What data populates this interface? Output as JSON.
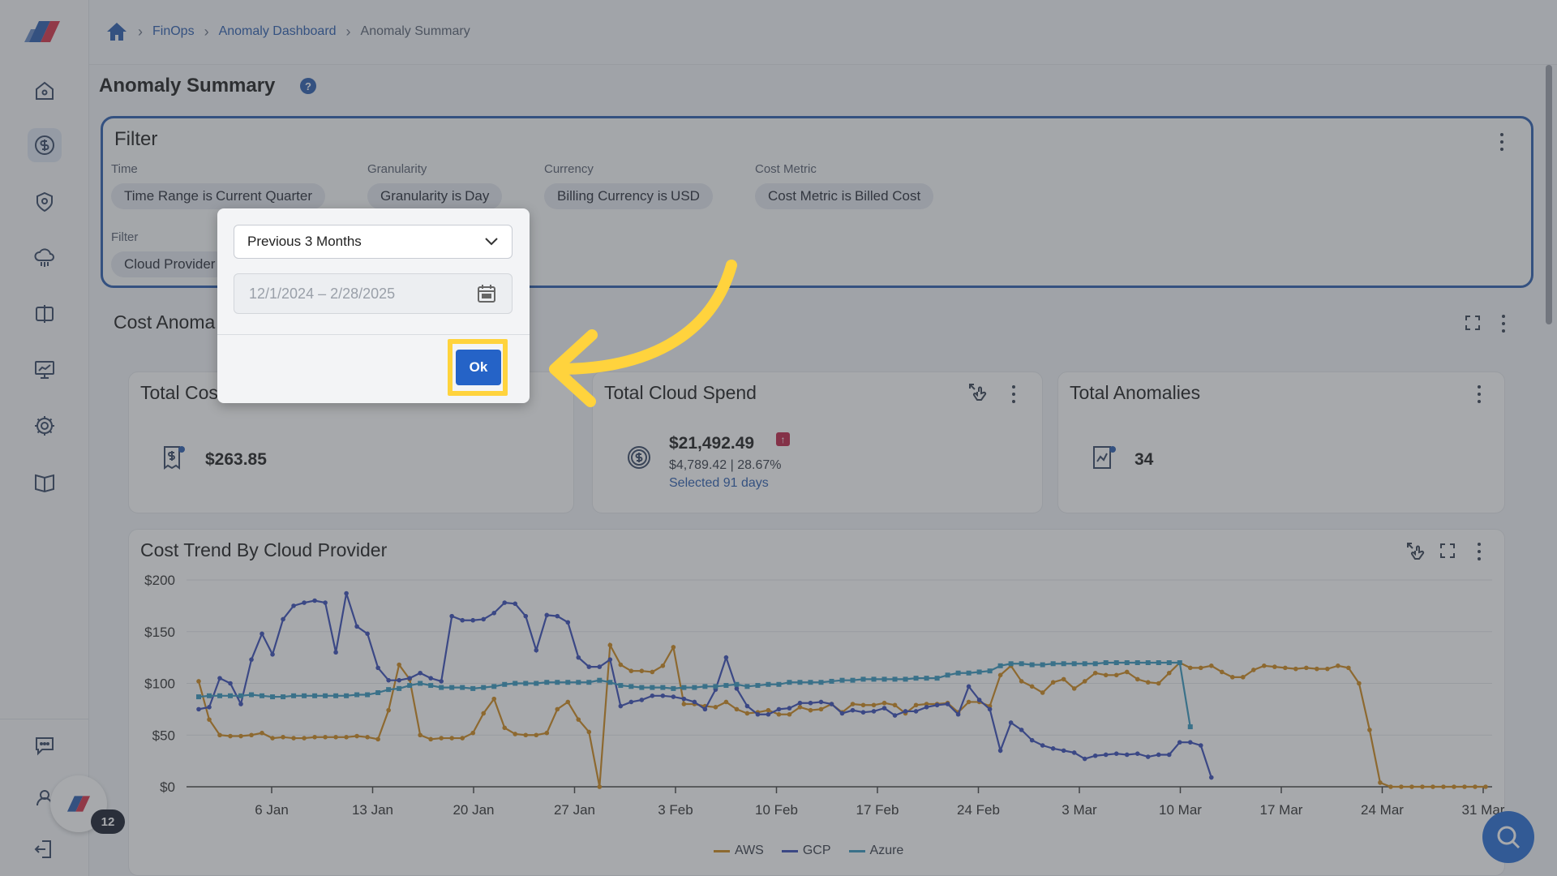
{
  "breadcrumb": {
    "items": [
      "FinOps",
      "Anomaly Dashboard"
    ],
    "current": "Anomaly Summary"
  },
  "page": {
    "title": "Anomaly Summary",
    "help": "?"
  },
  "filter": {
    "title": "Filter",
    "time_label": "Time",
    "granularity_label": "Granularity",
    "currency_label": "Currency",
    "cost_metric_label": "Cost Metric",
    "filter_label": "Filter",
    "chips": {
      "time": "Time Range is",
      "time_value": "Current Quarter",
      "granularity": "Granularity is",
      "granularity_value": "Day",
      "currency": "Billing Currency is",
      "currency_value": "USD",
      "metric": "Cost Metric is",
      "metric_value": "Billed Cost",
      "provider": "Cloud Provider"
    }
  },
  "section": {
    "title": "Cost Anoma"
  },
  "cards": {
    "total_cost": {
      "title": "Total Cos",
      "value": "$263.85"
    },
    "total_cloud": {
      "title": "Total Cloud Spend",
      "value": "$21,492.49",
      "change": "$4,789.42 | 28.67%",
      "link": "Selected 91 days"
    },
    "anomalies": {
      "title": "Total Anomalies",
      "value": "34"
    },
    "trend": {
      "title": "Cost Trend By Cloud Provider"
    }
  },
  "popover": {
    "range_option": "Previous 3 Months",
    "date_range": "12/1/2024 – 2/28/2025",
    "ok_label": "Ok"
  },
  "widgets": {
    "notification_count": "12"
  },
  "colors": {
    "aws": "#d08a1e",
    "gcp": "#3b4fb8",
    "azure": "#3a9ac0",
    "accent": "#2f5fb0",
    "highlight": "#ffd33d"
  },
  "chart_data": {
    "type": "line",
    "title": "Cost Trend By Cloud Provider",
    "y_ticks": [
      "$200",
      "$150",
      "$100",
      "$50",
      "$0"
    ],
    "ylim": [
      0,
      200
    ],
    "x_ticks": [
      "6 Jan",
      "13 Jan",
      "20 Jan",
      "27 Jan",
      "3 Feb",
      "10 Feb",
      "17 Feb",
      "24 Feb",
      "3 Mar",
      "10 Mar",
      "17 Mar",
      "24 Mar",
      "31 Mar"
    ],
    "legend": [
      "AWS",
      "GCP",
      "Azure"
    ],
    "series": [
      {
        "name": "AWS",
        "values": [
          102,
          65,
          50,
          49,
          49,
          50,
          52,
          47,
          48,
          47,
          47,
          48,
          48,
          48,
          48,
          49,
          48,
          46,
          74,
          118,
          104,
          50,
          46,
          47,
          47,
          47,
          52,
          71,
          85,
          57,
          51,
          50,
          50,
          52,
          75,
          82,
          65,
          53,
          0,
          137,
          118,
          112,
          112,
          111,
          117,
          135,
          80,
          80,
          78,
          77,
          82,
          75,
          71,
          72,
          74,
          70,
          70,
          77,
          74,
          75,
          80,
          72,
          80,
          79,
          79,
          81,
          79,
          71,
          79,
          80,
          80,
          81,
          72,
          82,
          82,
          78,
          108,
          117,
          102,
          97,
          91,
          101,
          104,
          95,
          102,
          110,
          108,
          108,
          111,
          104,
          101,
          100,
          110,
          120,
          115,
          115,
          117,
          111,
          106,
          106,
          113,
          117,
          116,
          115,
          114,
          115,
          114,
          114,
          117,
          115,
          100,
          55,
          4,
          0,
          0,
          0,
          0,
          0,
          0,
          0,
          0,
          0,
          0
        ]
      },
      {
        "name": "GCP",
        "values": [
          75,
          77,
          105,
          100,
          80,
          123,
          148,
          128,
          162,
          175,
          178,
          180,
          178,
          130,
          187,
          155,
          148,
          115,
          103,
          103,
          105,
          110,
          105,
          102,
          165,
          161,
          161,
          162,
          168,
          178,
          177,
          165,
          132,
          166,
          165,
          159,
          125,
          116,
          116,
          123,
          78,
          82,
          84,
          88,
          88,
          87,
          85,
          82,
          75,
          94,
          125,
          95,
          78,
          70,
          70,
          75,
          76,
          81,
          81,
          82,
          80,
          71,
          74,
          72,
          73,
          76,
          69,
          73,
          73,
          77,
          79,
          80,
          70,
          97,
          84,
          75,
          35,
          62,
          55,
          45,
          40,
          37,
          35,
          33,
          27,
          30,
          31,
          32,
          31,
          32,
          29,
          31,
          31,
          43,
          43,
          40,
          9
        ]
      },
      {
        "name": "Azure",
        "values": [
          87,
          88,
          88,
          88,
          88,
          89,
          88,
          87,
          87,
          88,
          88,
          88,
          88,
          88,
          88,
          89,
          89,
          91,
          94,
          95,
          98,
          100,
          98,
          96,
          96,
          96,
          95,
          96,
          97,
          99,
          100,
          100,
          100,
          101,
          101,
          101,
          101,
          101,
          103,
          101,
          98,
          97,
          96,
          96,
          96,
          95,
          96,
          96,
          97,
          97,
          98,
          99,
          97,
          98,
          99,
          99,
          101,
          101,
          101,
          101,
          102,
          103,
          103,
          104,
          104,
          104,
          104,
          104,
          105,
          105,
          105,
          108,
          110,
          110,
          111,
          112,
          117,
          119,
          119,
          118,
          118,
          119,
          119,
          119,
          119,
          119,
          120,
          120,
          120,
          120,
          120,
          120,
          120,
          120,
          58
        ]
      }
    ]
  }
}
